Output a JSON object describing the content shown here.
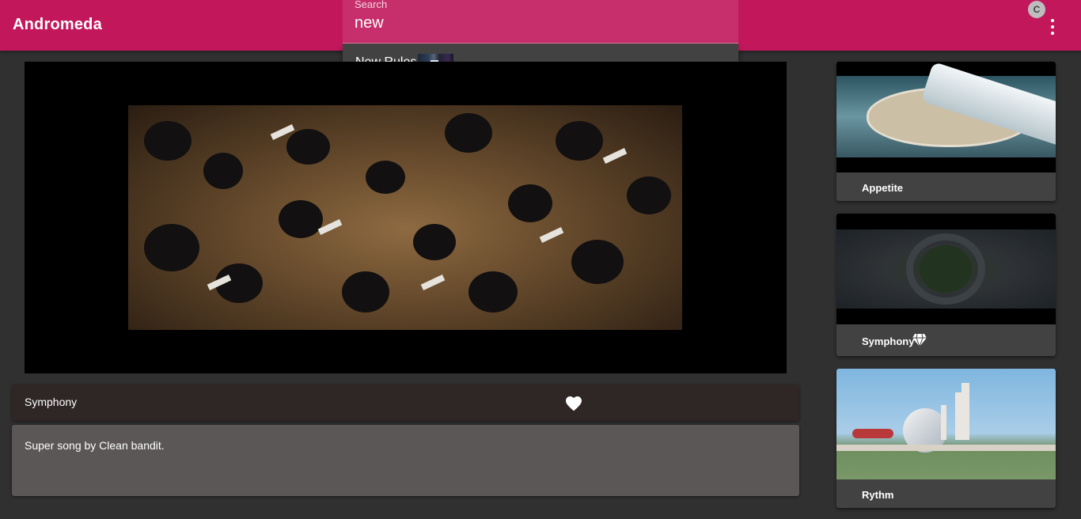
{
  "app": {
    "title": "Andromeda"
  },
  "user": {
    "avatar_initial": "C"
  },
  "search": {
    "label": "Search",
    "value": "new",
    "suggestions": [
      {
        "label": "New Rules"
      }
    ]
  },
  "player": {
    "title": "Symphony",
    "description": "Super song by Clean bandit.",
    "favorited": true
  },
  "related": [
    {
      "title": "Appetite",
      "badge": ""
    },
    {
      "title": "Symphony",
      "badge": "diamond-icon"
    },
    {
      "title": "Rythm",
      "badge": ""
    }
  ],
  "colors": {
    "primary": "#c2185b",
    "search_field": "#c62f6b",
    "background": "#303030",
    "card": "#424242",
    "title_bar": "#2f2626",
    "description_card": "#5b5757"
  }
}
